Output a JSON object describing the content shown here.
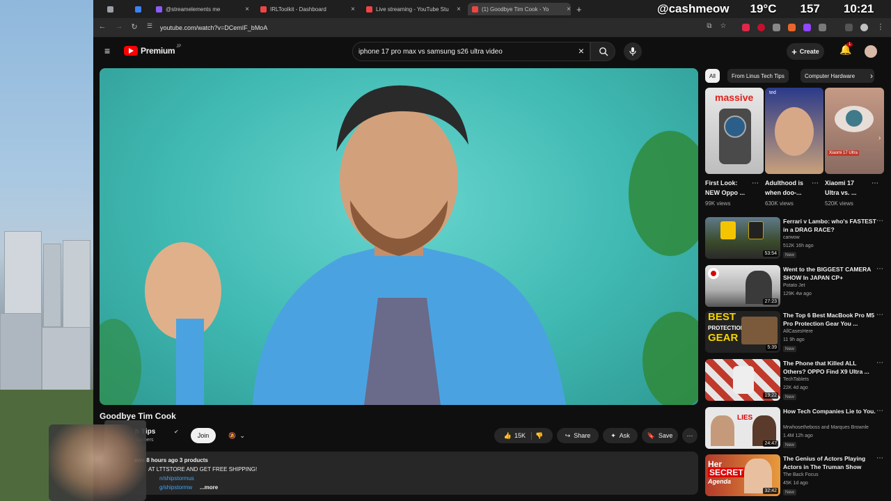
{
  "browser": {
    "tabs": [
      {
        "label": "",
        "color": "#9aa0a6"
      },
      {
        "label": "",
        "color": "#3b82f6"
      },
      {
        "label": "@streamelements me",
        "color": "#8b5cf6"
      },
      {
        "label": "IRLToolkit - Dashboard",
        "color": "#ef4444"
      },
      {
        "label": "Live streaming - YouTube Stu",
        "color": "#ef4444"
      },
      {
        "label": "(1) Goodbye Tim Cook - Yo",
        "color": "#ef4444"
      }
    ],
    "new_tab": "+",
    "url": "youtube.com/watch?v=DCemIF_bMoA"
  },
  "overlay": {
    "handle": "@cashmeow",
    "temp": "19°C",
    "count": "157",
    "time": "10:21"
  },
  "youtube": {
    "logo": "Premium",
    "logo_sup": "JP",
    "search_value": "iphone 17 pro max vs samsung s26 ultra video",
    "create_label": "Create",
    "notif_count": "1"
  },
  "video": {
    "title": "Goodbye Tim Cook",
    "channel_partial": "h Tips",
    "subs_partial": "scribers",
    "join_label": "Join",
    "likes": "15K",
    "share_label": "Share",
    "ask_label": "Ask",
    "save_label": "Save",
    "desc_line1": "ews  8 hours ago  3 products",
    "desc_line2": "AT LTTSTORE AND GET FREE SHIPPING!",
    "desc_line3": "n/shipstormus",
    "desc_line4": "g/shipstormw",
    "more_label": "...more"
  },
  "sidebar": {
    "chips": [
      "All",
      "From Linus Tech Tips",
      "Computer Hardware"
    ],
    "shorts": [
      {
        "title1": "First Look:",
        "title2": "NEW Oppo ...",
        "views": "99K views",
        "thumb_text": "massive"
      },
      {
        "title1": "Adulthood is",
        "title2": "when doo-...",
        "views": "630K views",
        "thumb_text": "ted"
      },
      {
        "title1": "Xiaomi 17",
        "title2": "Ultra vs. ...",
        "views": "520K views",
        "thumb_text": "Xiaomi 17 Ultra"
      }
    ],
    "recs": [
      {
        "title": "Ferrari v Lambo: who's FASTEST in a DRAG RACE?",
        "channel": "carwow",
        "meta": "512K  16h ago",
        "badge": "New",
        "duration": "53:54",
        "thumb": "#3a4a2a"
      },
      {
        "title": "Went to the BIGGEST CAMERA SHOW In JAPAN CP+",
        "channel": "Potato Jet",
        "meta": "129K  4w ago",
        "badge": "",
        "duration": "27:23",
        "thumb": "#8f8f8f"
      },
      {
        "title": "The Top 6 Best MacBook Pro M5 Pro Protection Gear You ...",
        "channel": "AllCasesHere",
        "meta": "11  9h ago",
        "badge": "New",
        "duration": "5:39",
        "thumb": "#2a2a2a"
      },
      {
        "title": "The Phone that Killed ALL Others? OPPO Find X9 Ultra ...",
        "channel": "TechTablets",
        "meta": "22K  4d ago",
        "badge": "New",
        "duration": "19:22",
        "thumb": "#c0392b"
      },
      {
        "title": "How Tech Companies Lie to You.",
        "channel": "Mrwhosetheboss  and Marques Brownle",
        "meta": "1.4M  12h ago",
        "badge": "New",
        "duration": "24:47",
        "thumb": "#d9d9d9"
      },
      {
        "title": "The Genius of Actors Playing Actors in The Truman Show",
        "channel": "The Back Focus",
        "meta": "45K  1d ago",
        "badge": "New",
        "duration": "32:42",
        "thumb": "#e89a3c"
      }
    ]
  }
}
